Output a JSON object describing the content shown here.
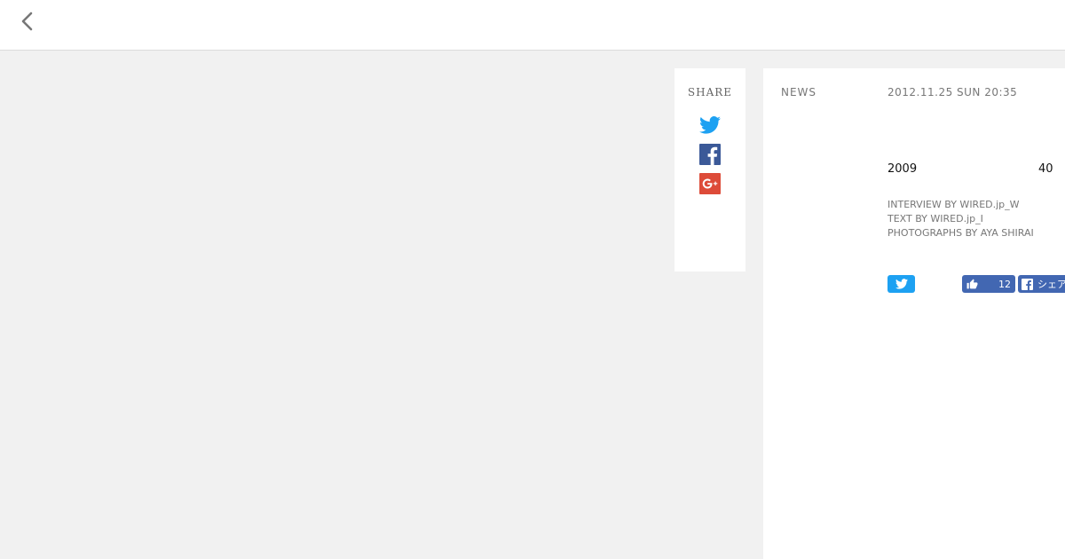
{
  "header": {
    "back_icon": "chevron-left-icon"
  },
  "share": {
    "title": "SHARE",
    "icons": [
      "twitter-icon",
      "facebook-icon",
      "google-plus-icon"
    ],
    "colors": {
      "twitter": "#1da1f2",
      "facebook": "#3b5998",
      "google_plus": "#dd4b39"
    }
  },
  "article": {
    "category": "NEWS",
    "date": "2012.11.25 SUN 20:35",
    "lead_year": "2009",
    "lead_number": "40",
    "credits": {
      "interview": "INTERVIEW BY WIRED.jp_W",
      "text": "TEXT BY WIRED.jp_I",
      "photographs": "PHOTOGRAPHS BY AYA SHIRAI"
    },
    "social": {
      "like_count": "12",
      "share_label": "シェア"
    }
  }
}
